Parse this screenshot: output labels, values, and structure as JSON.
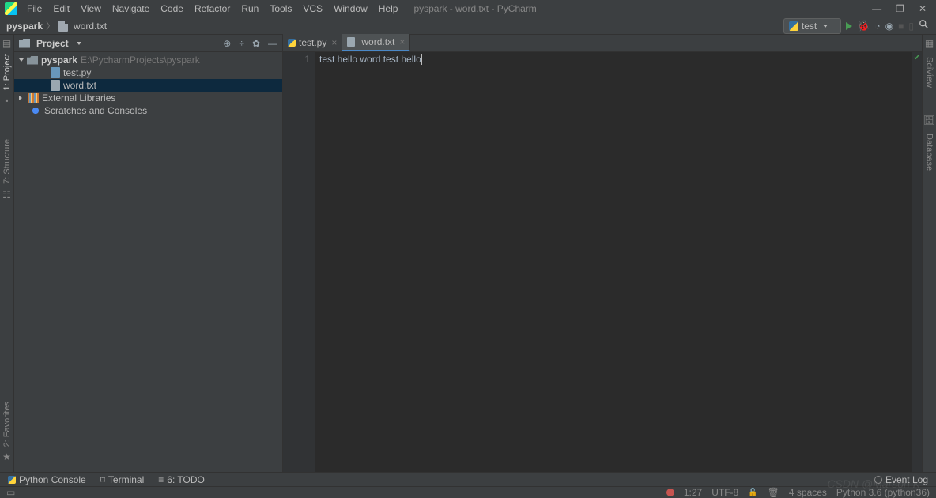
{
  "menu": [
    "File",
    "Edit",
    "View",
    "Navigate",
    "Code",
    "Refactor",
    "Run",
    "Tools",
    "VCS",
    "Window",
    "Help"
  ],
  "title": "pyspark - word.txt - PyCharm",
  "breadcrumb": {
    "root": "pyspark",
    "file": "word.txt"
  },
  "runconfig": "test",
  "sidebar": {
    "title": "Project",
    "project_name": "pyspark",
    "project_path": "E:\\PycharmProjects\\pyspark",
    "files": [
      "test.py",
      "word.txt"
    ],
    "external": "External Libraries",
    "scratch": "Scratches and Consoles"
  },
  "tabs": [
    {
      "name": "test.py",
      "active": false
    },
    {
      "name": "word.txt",
      "active": true
    }
  ],
  "editor": {
    "line_no": "1",
    "content": "test hello word test hello"
  },
  "left_labels": [
    "1: Project",
    "7: Structure",
    "2: Favorites"
  ],
  "right_labels": [
    "SciView",
    "Database"
  ],
  "toolwindows": {
    "python": "Python Console",
    "terminal": "Terminal",
    "todo": "6: TODO",
    "eventlog": "Event Log"
  },
  "status": {
    "pos": "1:27",
    "enc": "UTF-8",
    "indent": "4 spaces",
    "interpreter": "Python 3.6 (python36)"
  },
  "watermark": "CSDN @Marson K"
}
